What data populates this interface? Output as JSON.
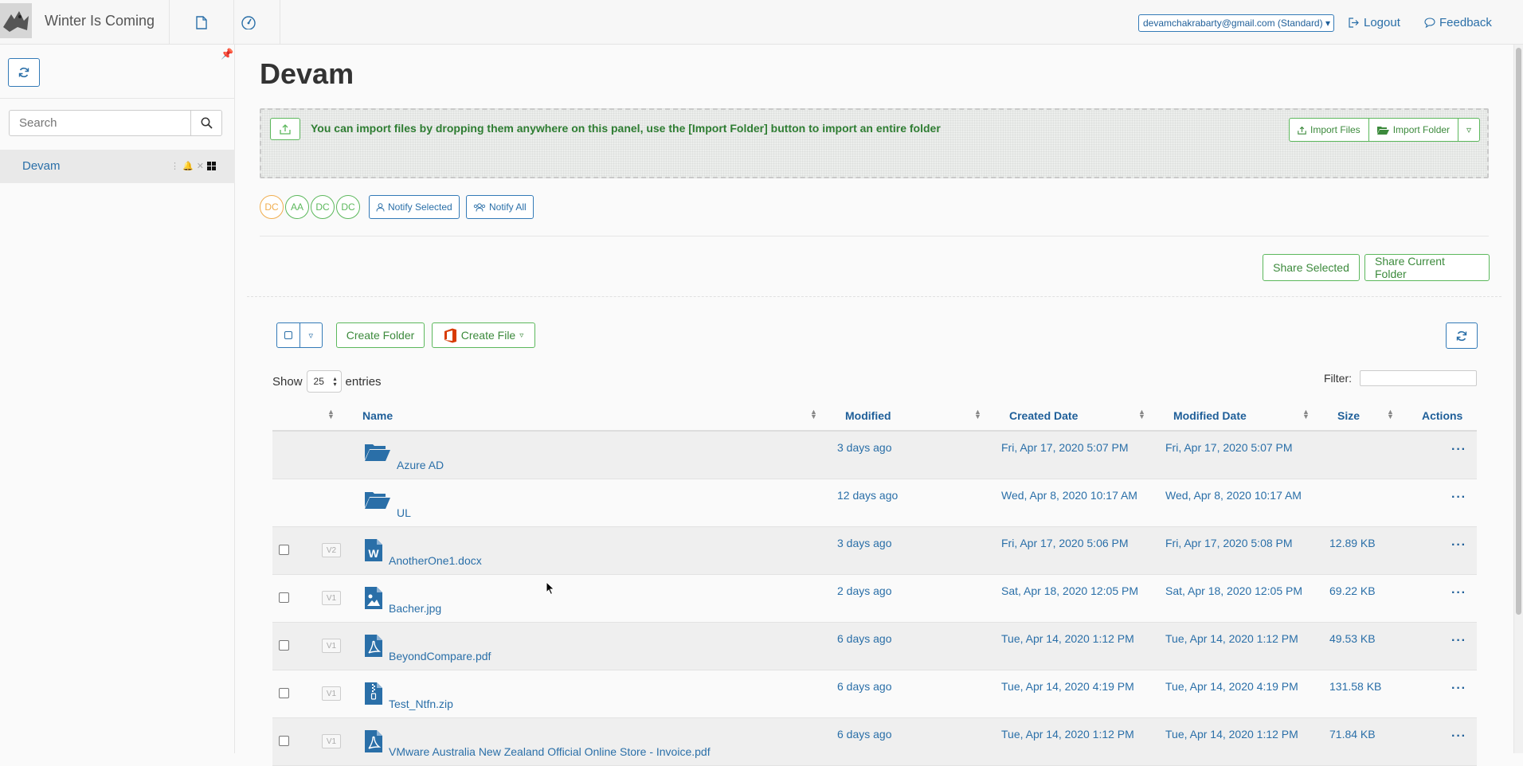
{
  "header": {
    "app_title": "Winter Is Coming",
    "account": "devamchakrabarty@gmail.com (Standard)",
    "logout_label": "Logout",
    "feedback_label": "Feedback"
  },
  "sidebar": {
    "search_placeholder": "Search",
    "tree_item": "Devam"
  },
  "main": {
    "title": "Devam",
    "drop_text": "You can import files by dropping them anywhere on this panel, use the [Import Folder] button to import an entire folder",
    "import_files_label": "Import Files",
    "import_folder_label": "Import Folder",
    "avatars": [
      "DC",
      "AA",
      "DC",
      "DC"
    ],
    "notify_selected_label": "Notify Selected",
    "notify_all_label": "Notify All",
    "share_selected_label": "Share Selected",
    "share_current_label": "Share Current Folder",
    "create_folder_label": "Create Folder",
    "create_file_label": "Create File",
    "show_label": "Show",
    "entries_value": "25",
    "entries_label": "entries",
    "filter_label": "Filter:"
  },
  "table": {
    "headers": {
      "name": "Name",
      "modified": "Modified",
      "created": "Created Date",
      "modified_date": "Modified Date",
      "size": "Size",
      "actions": "Actions"
    },
    "rows": [
      {
        "type": "folder",
        "version": "",
        "name": "Azure AD",
        "modified": "3 days ago",
        "created": "Fri, Apr 17, 2020 5:07 PM",
        "modified_date": "Fri, Apr 17, 2020 5:07 PM",
        "size": ""
      },
      {
        "type": "folder",
        "version": "",
        "name": "UL",
        "modified": "12 days ago",
        "created": "Wed, Apr 8, 2020 10:17 AM",
        "modified_date": "Wed, Apr 8, 2020 10:17 AM",
        "size": ""
      },
      {
        "type": "word",
        "version": "V2",
        "name": "AnotherOne1.docx",
        "modified": "3 days ago",
        "created": "Fri, Apr 17, 2020 5:06 PM",
        "modified_date": "Fri, Apr 17, 2020 5:08 PM",
        "size": "12.89 KB"
      },
      {
        "type": "image",
        "version": "V1",
        "name": "Bacher.jpg",
        "modified": "2 days ago",
        "created": "Sat, Apr 18, 2020 12:05 PM",
        "modified_date": "Sat, Apr 18, 2020 12:05 PM",
        "size": "69.22 KB"
      },
      {
        "type": "pdf",
        "version": "V1",
        "name": "BeyondCompare.pdf",
        "modified": "6 days ago",
        "created": "Tue, Apr 14, 2020 1:12 PM",
        "modified_date": "Tue, Apr 14, 2020 1:12 PM",
        "size": "49.53 KB"
      },
      {
        "type": "zip",
        "version": "V1",
        "name": "Test_Ntfn.zip",
        "modified": "6 days ago",
        "created": "Tue, Apr 14, 2020 4:19 PM",
        "modified_date": "Tue, Apr 14, 2020 4:19 PM",
        "size": "131.58 KB"
      },
      {
        "type": "pdf",
        "version": "V1",
        "name": "VMware Australia New Zealand Official Online Store - Invoice.pdf",
        "modified": "6 days ago",
        "created": "Tue, Apr 14, 2020 1:12 PM",
        "modified_date": "Tue, Apr 14, 2020 1:12 PM",
        "size": "71.84 KB"
      }
    ]
  },
  "colors": {
    "link_blue": "#2a6fa8",
    "success_green": "#5cb85c",
    "folder_blue": "#2a6fa8",
    "office_red": "#d83b01"
  }
}
